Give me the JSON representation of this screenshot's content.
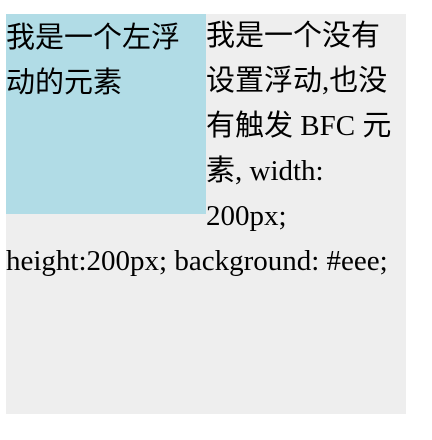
{
  "colors": {
    "page_background": "#ffffff",
    "container_background": "#eeeeee",
    "float_background": "#b1dce6",
    "text": "#000000"
  },
  "float_box": {
    "text": "我是一个左浮动的元素"
  },
  "non_float_box": {
    "text": "我是一个没有设置浮动,也没有触发 BFC 元素, width: 200px; height:200px; background: #eee;"
  }
}
